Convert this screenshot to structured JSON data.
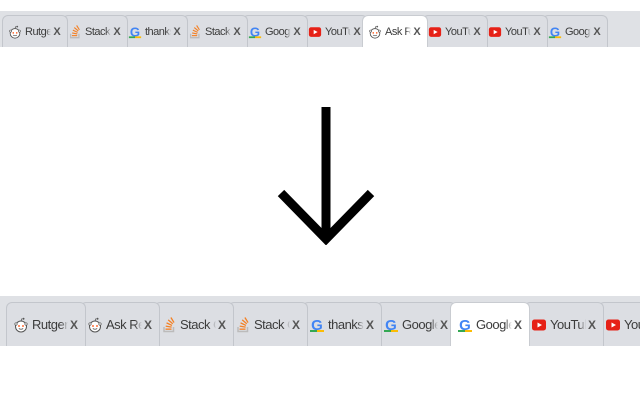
{
  "before_tabs": [
    {
      "title": "Rutgers Univ",
      "icon": "reddit-icon",
      "active": false
    },
    {
      "title": "Stack Overflow",
      "icon": "stackoverflow-icon",
      "active": false
    },
    {
      "title": "thanks for",
      "icon": "google-icon",
      "active": false
    },
    {
      "title": "Stack Overflow",
      "icon": "stackoverflow-icon",
      "active": false
    },
    {
      "title": "Google",
      "icon": "google-icon",
      "active": false
    },
    {
      "title": "YouTube",
      "icon": "youtube-icon",
      "active": false
    },
    {
      "title": "Ask Reddit",
      "icon": "reddit-icon",
      "active": true
    },
    {
      "title": "YouTube",
      "icon": "youtube-icon",
      "active": false
    },
    {
      "title": "YouTube",
      "icon": "youtube-icon",
      "active": false
    },
    {
      "title": "Google",
      "icon": "google-icon",
      "active": false
    }
  ],
  "after_tabs": [
    {
      "title": "Rutgers Univ",
      "icon": "reddit-icon",
      "active": false
    },
    {
      "title": "Ask Reddit",
      "icon": "reddit-icon",
      "active": false
    },
    {
      "title": "Stack Overflow",
      "icon": "stackoverflow-icon",
      "active": false
    },
    {
      "title": "Stack Overflow",
      "icon": "stackoverflow-icon",
      "active": false
    },
    {
      "title": "thanks for",
      "icon": "google-icon",
      "active": false
    },
    {
      "title": "Google",
      "icon": "google-icon",
      "active": false
    },
    {
      "title": "Google",
      "icon": "google-icon",
      "active": true
    },
    {
      "title": "YouTube",
      "icon": "youtube-icon",
      "active": false
    },
    {
      "title": "YouTube",
      "icon": "youtube-icon",
      "active": false
    }
  ],
  "close_label": "X",
  "arrow_icon": "down-arrow-icon",
  "colors": {
    "strip_bg": "#dfe1e5",
    "tab_bg": "#dcdee3",
    "active_tab_bg": "#ffffff",
    "youtube_red": "#e62117",
    "stackoverflow_orange": "#f48024",
    "reddit_orange": "#ff4500"
  }
}
